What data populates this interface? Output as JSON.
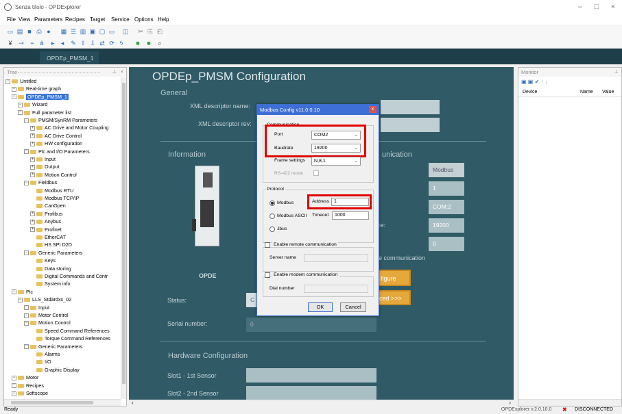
{
  "window": {
    "title": "Senza titolo - OPDExplorer"
  },
  "menu": [
    "File",
    "View",
    "Parameters",
    "Recipes",
    "Target",
    "Service",
    "Options",
    "Help"
  ],
  "tabs": {
    "active": "OPDEp_PMSM_1"
  },
  "tree": {
    "panel_title": "Tree",
    "items": [
      {
        "label": "Untitled",
        "indent": 0
      },
      {
        "label": "Real-time graph",
        "indent": 1
      },
      {
        "label": "OPDEp_PMSM_1",
        "indent": 1,
        "selected": true
      },
      {
        "label": "Wizard",
        "indent": 2
      },
      {
        "label": "Full parameter list",
        "indent": 2
      },
      {
        "label": "PMSM/SynRM Parameters",
        "indent": 3
      },
      {
        "label": "AC Drive and Motor Coupling",
        "indent": 4
      },
      {
        "label": "AC Drive Control",
        "indent": 4
      },
      {
        "label": "HW configuration",
        "indent": 4
      },
      {
        "label": "Plc and I/O Parameters",
        "indent": 3
      },
      {
        "label": "Input",
        "indent": 4
      },
      {
        "label": "Output",
        "indent": 4
      },
      {
        "label": "Motion Control",
        "indent": 4
      },
      {
        "label": "Fieldbus",
        "indent": 3
      },
      {
        "label": "Modbus RTU",
        "indent": 4
      },
      {
        "label": "Modbus TCP/IP",
        "indent": 4
      },
      {
        "label": "CanOpen",
        "indent": 4
      },
      {
        "label": "Profibus",
        "indent": 4
      },
      {
        "label": "Anybus",
        "indent": 4
      },
      {
        "label": "Profinet",
        "indent": 4
      },
      {
        "label": "EtherCAT",
        "indent": 4
      },
      {
        "label": "HS SPI D2D",
        "indent": 4
      },
      {
        "label": "Generic Parameters",
        "indent": 3
      },
      {
        "label": "Keys",
        "indent": 4
      },
      {
        "label": "Data storing",
        "indent": 4
      },
      {
        "label": "Digital Commands and Contr",
        "indent": 4
      },
      {
        "label": "System info",
        "indent": 4
      },
      {
        "label": "Plc",
        "indent": 1
      },
      {
        "label": "LLS_Stdardxx_02",
        "indent": 2
      },
      {
        "label": "Input",
        "indent": 3
      },
      {
        "label": "Motor Control",
        "indent": 3
      },
      {
        "label": "Motion Control",
        "indent": 3
      },
      {
        "label": "Speed Command References",
        "indent": 4
      },
      {
        "label": "Torque Command References",
        "indent": 4
      },
      {
        "label": "Generic Parameters",
        "indent": 3
      },
      {
        "label": "Alarms",
        "indent": 4
      },
      {
        "label": "I/O",
        "indent": 4
      },
      {
        "label": "Graphic Display",
        "indent": 4
      },
      {
        "label": "Motor",
        "indent": 1
      },
      {
        "label": "Recipes",
        "indent": 1
      },
      {
        "label": "Softscope",
        "indent": 1
      }
    ]
  },
  "main": {
    "title": "OPDEp_PMSM Configuration",
    "general": "General",
    "xml_name_label": "XML descriptor name:",
    "xml_rev_label": "XML descriptor rev:",
    "information": "Information",
    "communication_partial": "unication",
    "device_name": "OPDE",
    "comm_values": [
      "Modbus",
      "1",
      "COM:2",
      "19200",
      "0"
    ],
    "comm_label_partial": ":e:",
    "remote_partial": "e communication",
    "configure_btn": "figure",
    "advanced_btn": "ced >>>",
    "status_label": "Status:",
    "status_partial": "C",
    "serial_label": "Serial number:",
    "serial_value": "0",
    "hw_config": "Hardware Configuration",
    "slot1": "Slot1 - 1st Sensor",
    "slot2": "Slot2 - 2nd Sensor"
  },
  "monitor": {
    "title": "Monitor",
    "cols": [
      "Device",
      "Name",
      "Value"
    ]
  },
  "dialog": {
    "title": "Modbus Config v11.0.0.10",
    "close": "x",
    "group_comm": "Communication",
    "port_label": "Port",
    "port_value": "COM2",
    "baud_label": "Baudrate",
    "baud_value": "19200",
    "frame_label": "Frame settings",
    "frame_value": "N,8,1",
    "rs422_label": "RS-422 mode",
    "group_protocol": "Protocol",
    "proto_modbus": "Modbus",
    "proto_ascii": "Modbus ASCII",
    "proto_jbus": "Jbus",
    "address_label": "Address",
    "address_value": "1",
    "timeout_label": "Timeout",
    "timeout_value": "1000",
    "remote_label": "Enable remote communication",
    "server_label": "Server name",
    "modem_label": "Enable modem communication",
    "dial_label": "Dial number",
    "ok": "OK",
    "cancel": "Cancel"
  },
  "status": {
    "left": "Ready",
    "version": "OPDExplorer v.2.0.10.0",
    "connection": "DISCONNECTED"
  }
}
